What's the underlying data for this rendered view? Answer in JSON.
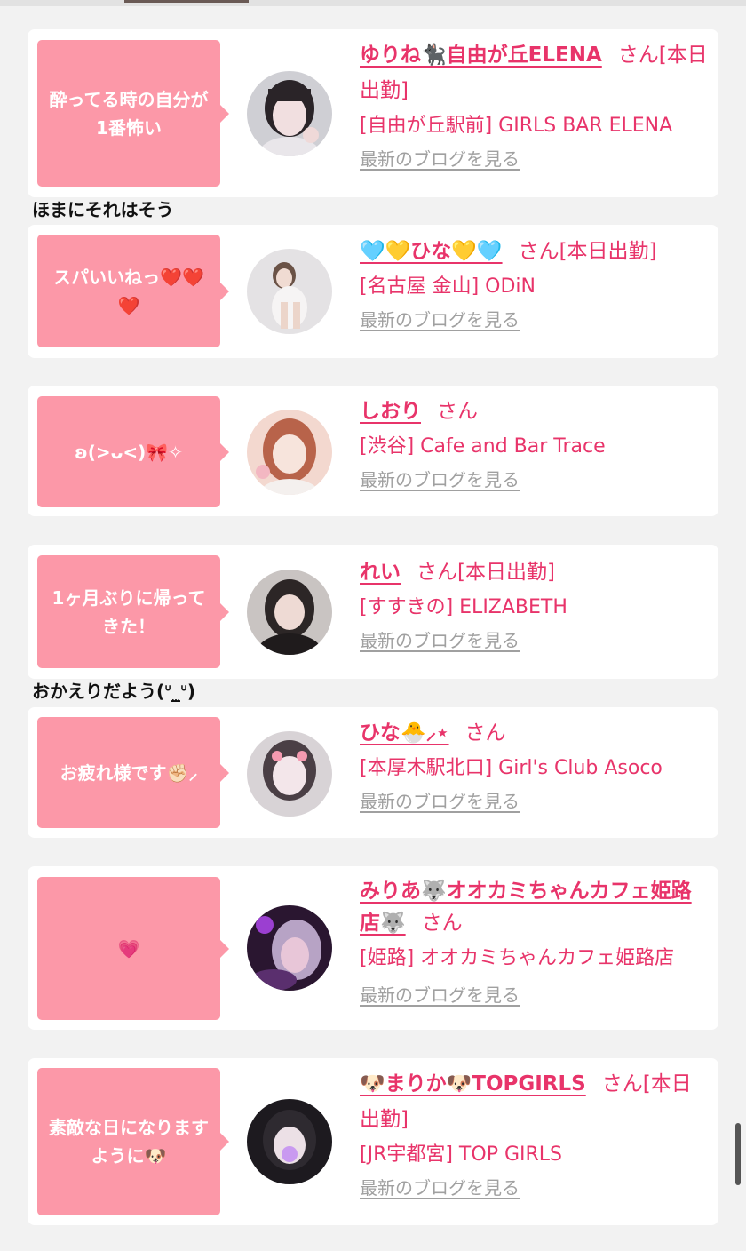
{
  "colors": {
    "accent": "#e8346a",
    "bubble": "#fc98a8",
    "link_gray": "#a0a0a0",
    "page_bg": "#f2f2f2"
  },
  "san_label": "さん",
  "blog_link_label": "最新のブログを見る",
  "entries": [
    {
      "comment": "酔ってる時の自分が1番怖い",
      "name": "ゆりね🐈‍⬛自由が丘ELENA",
      "suffix": "[本日出勤]",
      "shop": "[自由が丘駅前] GIRLS BAR ELENA",
      "reply": "ほまにそれはそう"
    },
    {
      "comment": "スパいいねっ❤️❤️❤️",
      "name": "🩵💛ひな💛🩵",
      "suffix": "[本日出勤]",
      "shop": "[名古屋 金山] ODiN",
      "reply": ""
    },
    {
      "comment": "ʚ(>ᴗ<)🎀✧",
      "name": "しおり",
      "suffix": "",
      "shop": "[渋谷] Cafe and Bar Trace",
      "reply": ""
    },
    {
      "comment": "1ヶ月ぶりに帰ってきた！",
      "name": "れい",
      "suffix": "[本日出勤]",
      "shop": "[すすきの] ELIZABETH",
      "reply": "おかえりだよう(ᐡ_̫ᐡ)"
    },
    {
      "comment": "お疲れ様です✊🏻⸝",
      "name": "ひな🐣⸝⋆",
      "suffix": "",
      "shop": "[本厚木駅北口] Girl's Club Asoco",
      "reply": ""
    },
    {
      "comment": "💗",
      "name": "みりあ🐺オオカミちゃんカフェ姫路店🐺",
      "suffix": "",
      "shop": "[姫路] オオカミちゃんカフェ姫路店",
      "reply": ""
    },
    {
      "comment": "素敵な日になりますように🐶",
      "name": "🐶まりか🐶TOPGIRLS",
      "suffix": "[本日出勤]",
      "shop": "[JR宇都宮] TOP GIRLS",
      "reply": ""
    }
  ]
}
